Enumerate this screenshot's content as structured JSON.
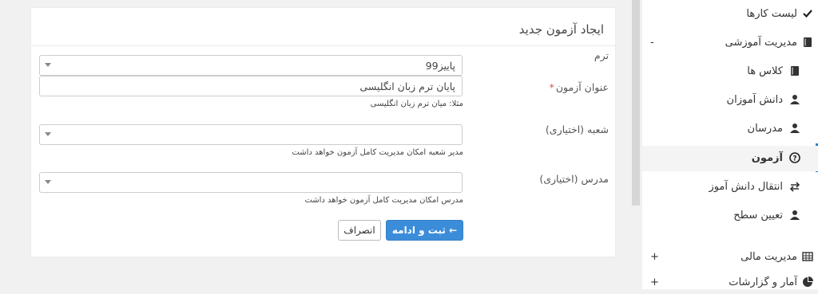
{
  "form": {
    "title": "ایجاد آزمون جدید",
    "term": {
      "label": "ترم",
      "value": "پاییز99"
    },
    "exam_title": {
      "label": "عنوان آزمون",
      "required_mark": "*",
      "value": "پایان ترم زبان انگلیسی",
      "help": "مثلا: میان ترم زبان انگلیسی"
    },
    "branch": {
      "label": "شعبه (اختیاری)",
      "help": "مدیر شعبه امکان مدیریت کامل آزمون خواهد داشت"
    },
    "teacher": {
      "label": "مدرس (اختیاری)",
      "help": "مدرس امکان مدیریت کامل آزمون خواهد داشت"
    },
    "submit_label": "ثبت و ادامه",
    "cancel_label": "انصراف"
  },
  "sidebar": {
    "items": [
      {
        "label": "لیست کارها",
        "icon": "check-icon"
      },
      {
        "label": "مدیریت آموزشی",
        "icon": "book-icon",
        "toggle": "-"
      },
      {
        "label": "کلاس ها",
        "icon": "book-icon"
      },
      {
        "label": "دانش آموزان",
        "icon": "user-icon"
      },
      {
        "label": "مدرسان",
        "icon": "user-icon"
      },
      {
        "label": "آزمون",
        "icon": "question-circle-icon",
        "active": true
      },
      {
        "label": "انتقال دانش آموز",
        "icon": "exchange-icon"
      },
      {
        "label": "تعیین سطح",
        "icon": "user-icon"
      },
      {
        "label": "مدیریت مالی",
        "icon": "table-icon",
        "toggle": "+"
      },
      {
        "label": "آمار و گزارشات",
        "icon": "pie-chart-icon",
        "toggle": "+"
      }
    ]
  },
  "colors": {
    "primary": "#3c8dd9",
    "active_bar": "#2c7fbf",
    "required": "#d9534f"
  }
}
